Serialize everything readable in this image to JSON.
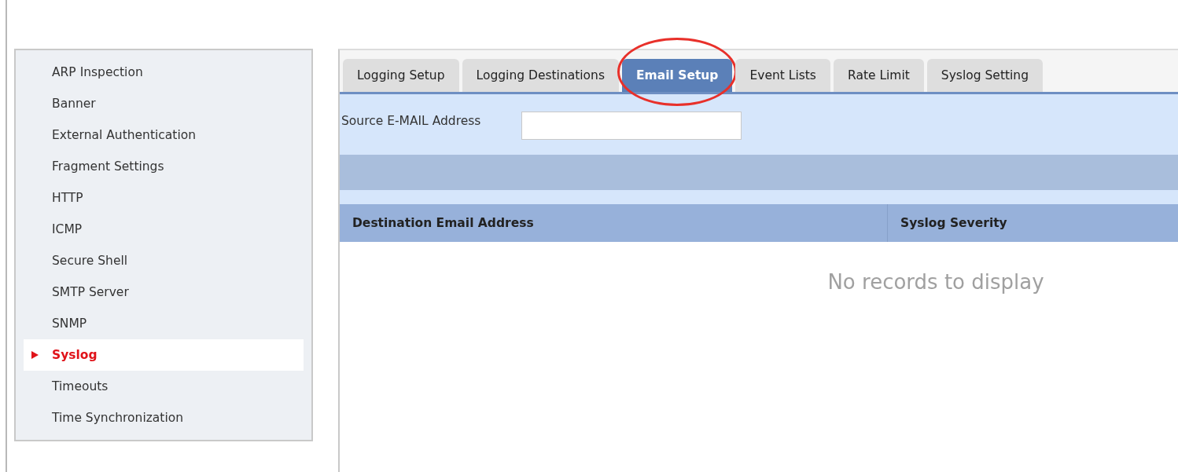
{
  "sidebar": {
    "items": [
      {
        "label": "ARP Inspection",
        "selected": false
      },
      {
        "label": "Banner",
        "selected": false
      },
      {
        "label": "External Authentication",
        "selected": false
      },
      {
        "label": "Fragment Settings",
        "selected": false
      },
      {
        "label": "HTTP",
        "selected": false
      },
      {
        "label": "ICMP",
        "selected": false
      },
      {
        "label": "Secure Shell",
        "selected": false
      },
      {
        "label": "SMTP Server",
        "selected": false
      },
      {
        "label": "SNMP",
        "selected": false
      },
      {
        "label": "Syslog",
        "selected": true
      },
      {
        "label": "Timeouts",
        "selected": false
      },
      {
        "label": "Time Synchronization",
        "selected": false
      }
    ]
  },
  "tabs": [
    {
      "label": "Logging Setup",
      "selected": false
    },
    {
      "label": "Logging Destinations",
      "selected": false
    },
    {
      "label": "Email Setup",
      "selected": true,
      "circled": true
    },
    {
      "label": "Event Lists",
      "selected": false
    },
    {
      "label": "Rate Limit",
      "selected": false
    },
    {
      "label": "Syslog Setting",
      "selected": false
    }
  ],
  "form": {
    "source_label": "Source E-MAIL Address"
  },
  "table": {
    "columns": [
      "Destination Email Address",
      "Syslog Severity"
    ],
    "empty_message": "No records to display"
  }
}
